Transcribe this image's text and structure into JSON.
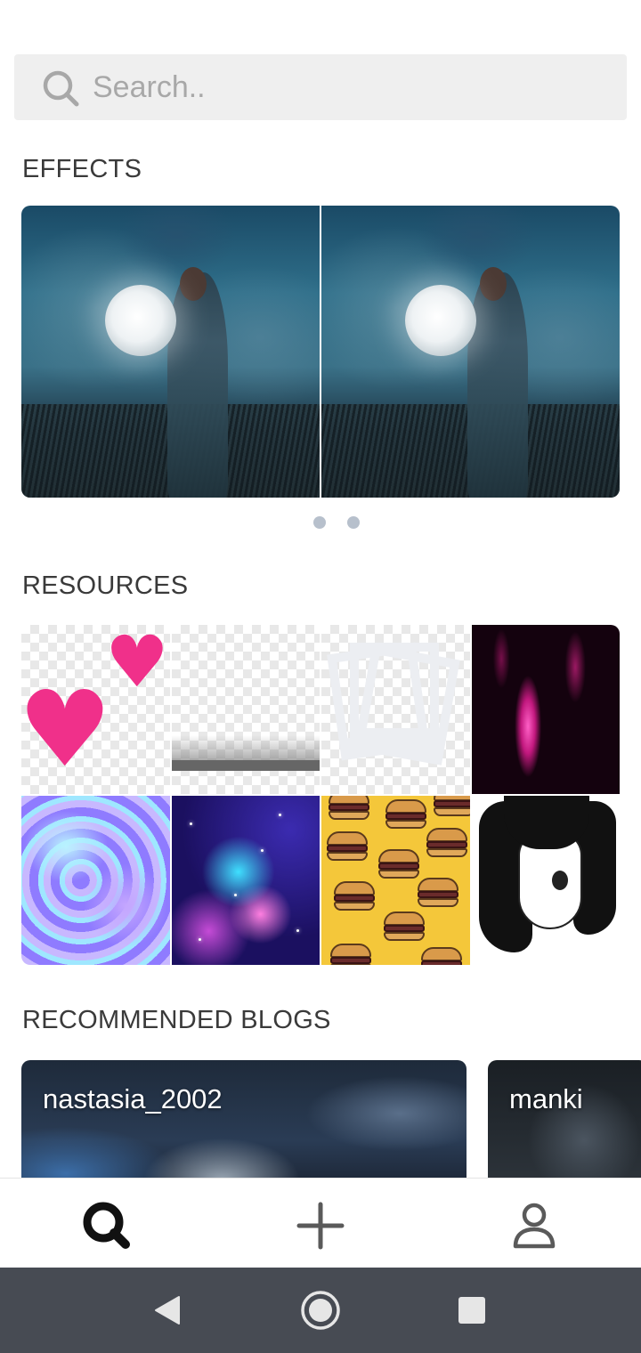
{
  "search": {
    "placeholder": "Search.."
  },
  "sections": {
    "effects_title": "EFFECTS",
    "resources_title": "RESOURCES",
    "blogs_title": "RECOMMENDED BLOGS"
  },
  "effects": {
    "items": [
      {
        "name": "moon-girl-original"
      },
      {
        "name": "moon-girl-effect"
      }
    ],
    "pager": {
      "count": 2,
      "active_index": 0
    }
  },
  "resources": {
    "items": [
      {
        "name": "hearts-sticker"
      },
      {
        "name": "gradient-overlay"
      },
      {
        "name": "polaroid-frames"
      },
      {
        "name": "pink-light-streak"
      },
      {
        "name": "holographic-texture"
      },
      {
        "name": "galaxy-background"
      },
      {
        "name": "burger-pattern"
      },
      {
        "name": "manga-girl"
      }
    ]
  },
  "blogs": [
    {
      "name": "nastasia_2002"
    },
    {
      "name": "manki"
    }
  ],
  "bottom_nav": {
    "items": [
      {
        "icon": "search-icon",
        "active": true
      },
      {
        "icon": "plus-icon",
        "active": false
      },
      {
        "icon": "profile-icon",
        "active": false
      }
    ]
  },
  "colors": {
    "accent": "#111111",
    "search_bg": "#efefef",
    "placeholder": "#a8a8a8",
    "section_text": "#3a3a3a",
    "pager_dot": "#b7c0cc",
    "system_nav_bg": "#474b53"
  }
}
